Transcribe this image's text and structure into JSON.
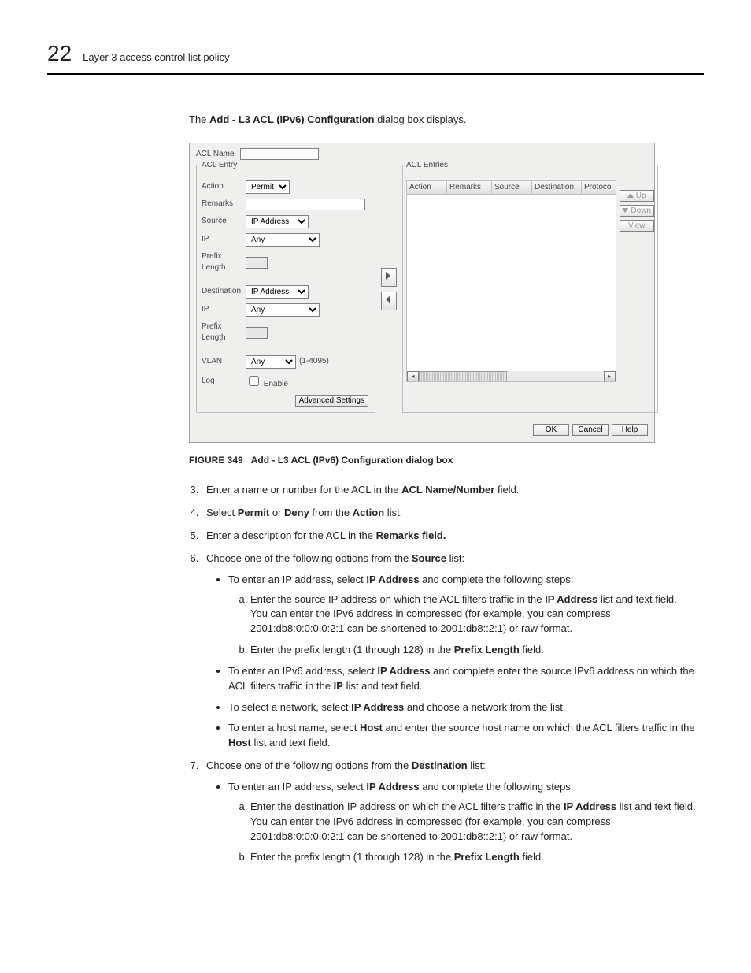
{
  "header": {
    "page_number": "22",
    "section_title": "Layer 3 access control list policy"
  },
  "intro": {
    "prefix": "The ",
    "bold": "Add - L3 ACL (IPv6) Configuration",
    "suffix": " dialog box displays."
  },
  "dialog": {
    "acl_name_label": "ACL Name",
    "acl_entry_title": "ACL Entry",
    "acl_entries_title": "ACL Entries",
    "fields": {
      "action_label": "Action",
      "action_value": "Permit",
      "remarks_label": "Remarks",
      "source_label": "Source",
      "source_value": "IP Address",
      "ip_label": "IP",
      "ip_value": "Any",
      "prefix_label": "Prefix Length",
      "dest_label": "Destination",
      "dest_value": "IP Address",
      "ip2_label": "IP",
      "ip2_value": "Any",
      "prefix2_label": "Prefix Length",
      "vlan_label": "VLAN",
      "vlan_value": "Any",
      "vlan_range": "(1-4095)",
      "log_label": "Log",
      "log_cb": "Enable",
      "advanced_btn": "Advanced Settings"
    },
    "table_headers": [
      "Action",
      "Remarks",
      "Source",
      "Destination",
      "Protocol"
    ],
    "side_buttons": {
      "up": "Up",
      "down": "Down",
      "view": "View"
    },
    "footer_buttons": {
      "ok": "OK",
      "cancel": "Cancel",
      "help": "Help"
    }
  },
  "figure": {
    "number": "FIGURE 349",
    "caption": "Add - L3 ACL (IPv6) Configuration dialog box"
  },
  "steps": {
    "s3": {
      "pre": "Enter a name or number for the ACL in the ",
      "b1": "ACL Name/Number",
      "post": " field."
    },
    "s4": {
      "t": [
        "Select ",
        "Permit",
        " or ",
        "Deny",
        " from the ",
        "Action",
        " list."
      ]
    },
    "s5": {
      "pre": "Enter a description for the ACL in the ",
      "b1": "Remarks field."
    },
    "s6": {
      "pre": "Choose one of the following options from the ",
      "b1": "Source",
      "post": " list:",
      "b_a": {
        "pre": "To enter an IP address, select ",
        "b1": "IP Address",
        "post": " and complete the following steps:"
      },
      "b_a_a": {
        "line1_pre": "Enter the source IP address on which the ACL filters traffic in the ",
        "b1": "IP Address",
        "line1_post": " list and text field.",
        "line2": "You can enter the IPv6 address in compressed (for example, you can compress 2001:db8:0:0:0:0:2:1 can be shortened to 2001:db8::2:1) or raw format."
      },
      "b_a_b": {
        "pre": "Enter the prefix length (1 through 128) in the ",
        "b1": "Prefix Length",
        "post": " field."
      },
      "b_b": {
        "t": [
          "To enter an IPv6 address, select ",
          "IP Address",
          " and complete enter the source IPv6 address on which the ACL filters traffic in the ",
          "IP",
          " list and text field."
        ]
      },
      "b_c": {
        "t": [
          "To select a network, select ",
          "IP Address",
          " and choose a network from the list."
        ]
      },
      "b_d": {
        "t": [
          "To enter a host name, select ",
          "Host",
          " and enter the source host name on which the ACL filters traffic in the ",
          "Host",
          " list and text field."
        ]
      }
    },
    "s7": {
      "pre": "Choose one of the following options from the ",
      "b1": "Destination",
      "post": " list:",
      "b_a": {
        "pre": "To enter an IP address, select ",
        "b1": "IP Address",
        "post": " and complete the following steps:"
      },
      "b_a_a": {
        "line1_pre": "Enter the destination IP address on which the ACL filters traffic in the ",
        "b1": "IP Address",
        "line1_post": " list and text field.",
        "line2": "You can enter the IPv6 address in compressed (for example, you can compress 2001:db8:0:0:0:0:2:1 can be shortened to 2001:db8::2:1) or raw format."
      },
      "b_a_b": {
        "pre": "Enter the prefix length (1 through 128) in the ",
        "b1": "Prefix Length",
        "post": " field."
      }
    }
  }
}
